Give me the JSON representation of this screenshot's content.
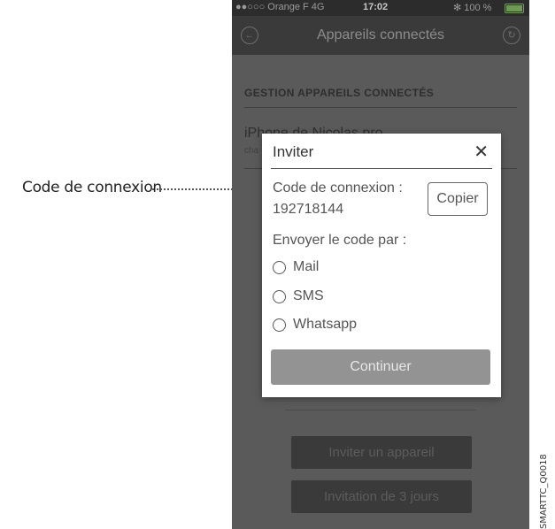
{
  "callout": {
    "label": "Code de connexion"
  },
  "status_bar": {
    "carrier": "●●○○○ Orange F  4G",
    "time": "17:02",
    "battery": "✻ 100 %",
    "battery_level": 1.0
  },
  "nav": {
    "title": "Appareils connectés"
  },
  "section": {
    "title": "GESTION APPAREILS CONNECTÉS",
    "device_name": "iPhone de Nicolas pro",
    "device_sub": "cha"
  },
  "buttons": {
    "invite_device": "Inviter un appareil",
    "invite_3_days": "Invitation de 3 jours"
  },
  "modal": {
    "title": "Inviter",
    "close": "✕",
    "code_label": "Code de connexion :",
    "code_value": "192718144",
    "copy": "Copier",
    "send_label": "Envoyer le code par :",
    "options": [
      "Mail",
      "SMS",
      "Whatsapp"
    ],
    "continue": "Continuer"
  },
  "watermark": "SMARTTC_Q0018"
}
